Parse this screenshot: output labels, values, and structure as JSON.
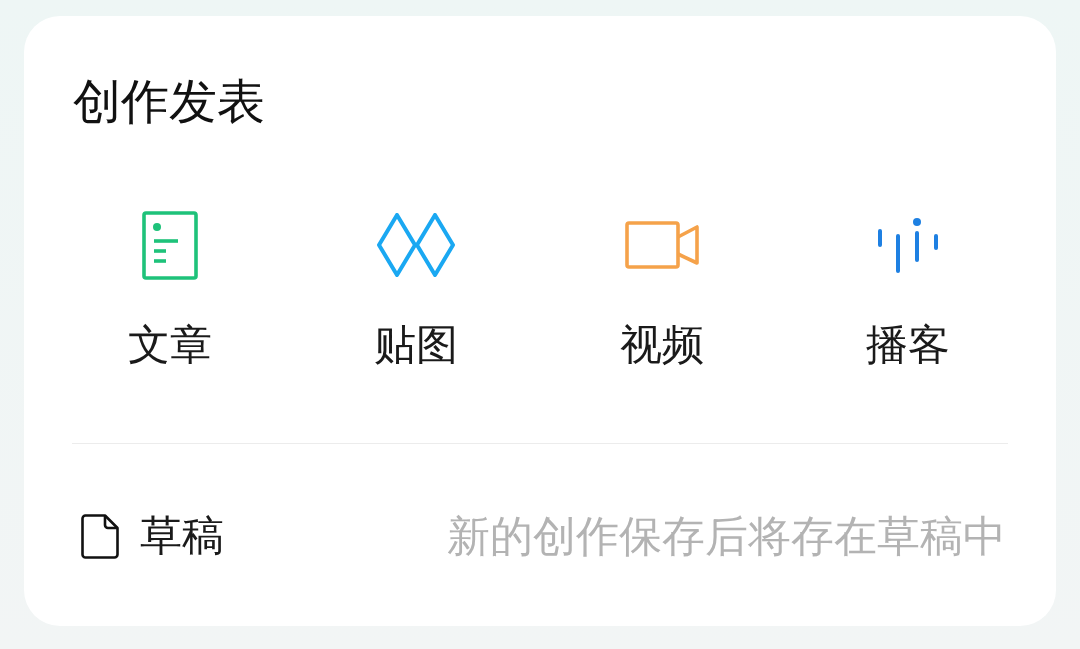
{
  "title": "创作发表",
  "actions": [
    {
      "kind": "article",
      "label": "文章",
      "color": "#1ec27a"
    },
    {
      "kind": "image",
      "label": "贴图",
      "color": "#1aa8f2"
    },
    {
      "kind": "video",
      "label": "视频",
      "color": "#f5a24a"
    },
    {
      "kind": "podcast",
      "label": "播客",
      "color": "#1e80e2"
    }
  ],
  "drafts": {
    "label": "草稿",
    "hint": "新的创作保存后将存在草稿中"
  }
}
